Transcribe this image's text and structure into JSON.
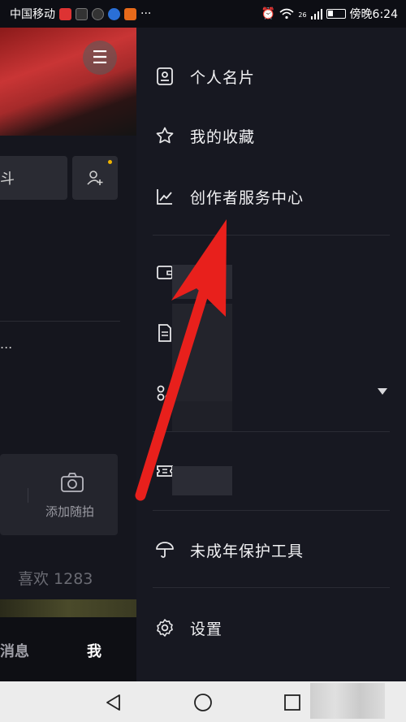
{
  "status_bar": {
    "carrier": "中国移动",
    "more": "···",
    "network": "26",
    "time": "傍晚6:24"
  },
  "background_page": {
    "edit_fragment": "斗",
    "ellipsis": "...",
    "add_moment_label": "添加随拍",
    "likes_label": "喜欢 1283",
    "nav_messages": "消息",
    "nav_me": "我"
  },
  "drawer": {
    "items": [
      {
        "label": "个人名片",
        "icon": "contact-card-icon"
      },
      {
        "label": "我的收藏",
        "icon": "star-icon"
      },
      {
        "label": "创作者服务中心",
        "icon": "chart-line-icon"
      },
      {
        "label": "",
        "icon": "wallet-icon"
      },
      {
        "label": "",
        "icon": "document-icon"
      },
      {
        "label": "",
        "icon": "apps-icon"
      },
      {
        "label": "",
        "icon": "ticket-icon"
      },
      {
        "label": "未成年保护工具",
        "icon": "umbrella-icon"
      },
      {
        "label": "设置",
        "icon": "gear-icon"
      }
    ]
  },
  "colors": {
    "drawer_bg": "#171821",
    "annotation_arrow": "#e8201c"
  }
}
